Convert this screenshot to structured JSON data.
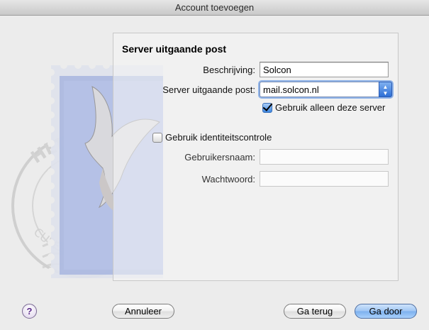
{
  "window": {
    "title": "Account toevoegen"
  },
  "form": {
    "section_title": "Server uitgaande post",
    "description_label": "Beschrijving:",
    "description_value": "Solcon",
    "outgoing_server_label": "Server uitgaande post:",
    "outgoing_server_value": "mail.solcon.nl",
    "use_only_this_server_label": "Gebruik alleen deze server",
    "use_only_this_server_checked": true,
    "use_authentication_label": "Gebruik identiteitscontrole",
    "use_authentication_checked": false,
    "username_label": "Gebruikersnaam:",
    "username_value": "",
    "password_label": "Wachtwoord:",
    "password_value": ""
  },
  "stamp": {
    "text_top": "HELLO FR",
    "text_bottom": "CUPERTINO, CA"
  },
  "buttons": {
    "help": "?",
    "cancel": "Annuleer",
    "back": "Ga terug",
    "continue": "Ga door"
  },
  "colors": {
    "accent_blue": "#3d86e0",
    "default_button": "#9fc6f3",
    "help_purple": "#5b2a8a"
  }
}
